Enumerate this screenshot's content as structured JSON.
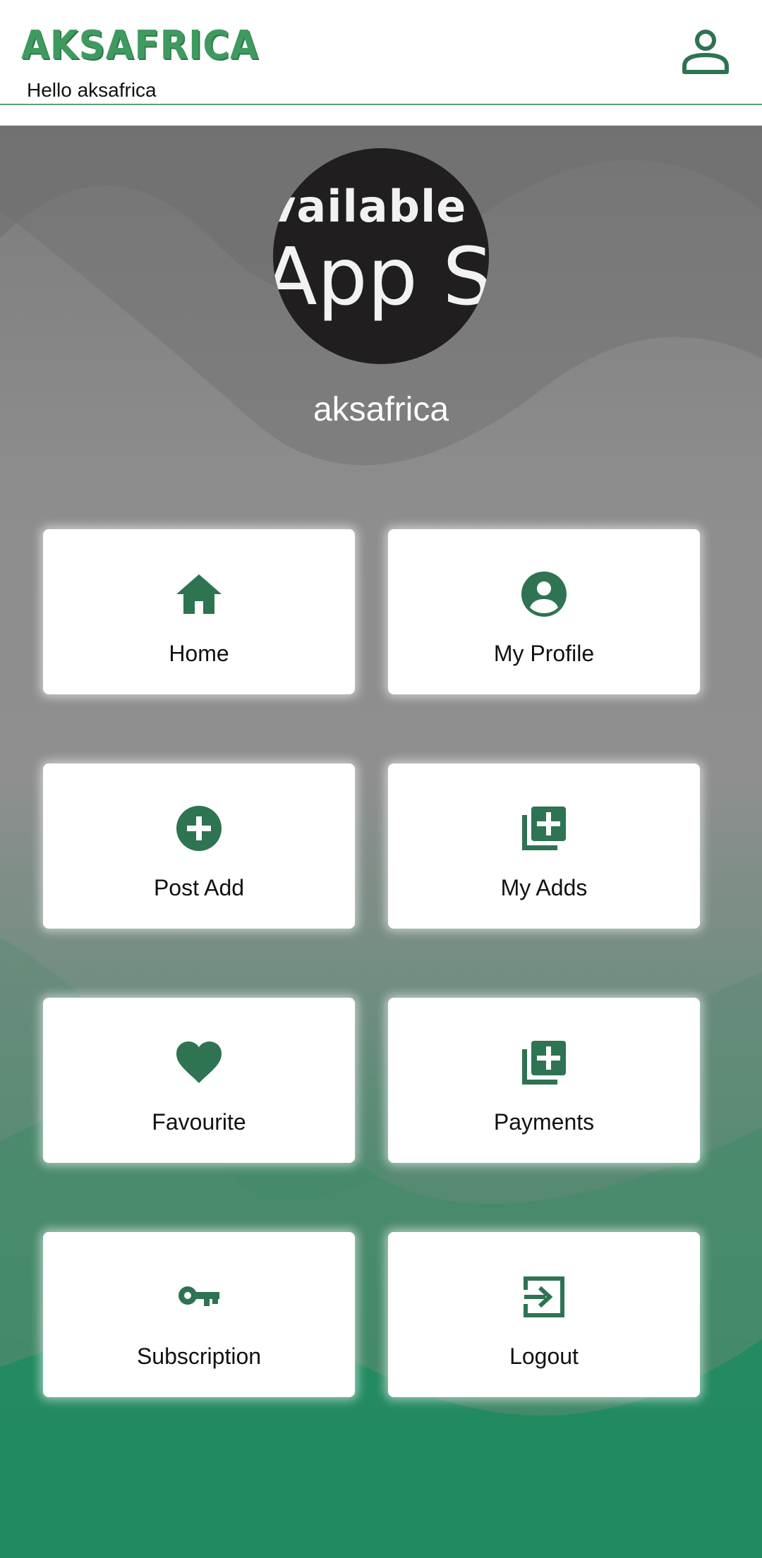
{
  "header": {
    "logo_text": "AKSAFRICA",
    "greeting": "Hello aksafrica",
    "profile_icon": "person-outline-icon"
  },
  "profile": {
    "avatar_text_line1": "vailable",
    "avatar_text_line2": "App S",
    "username": "aksafrica"
  },
  "menu": [
    {
      "label": "Home",
      "icon": "home-icon"
    },
    {
      "label": "My Profile",
      "icon": "account-circle-icon"
    },
    {
      "label": "Post Add",
      "icon": "add-circle-icon"
    },
    {
      "label": "My Adds",
      "icon": "library-add-icon"
    },
    {
      "label": "Favourite",
      "icon": "heart-icon"
    },
    {
      "label": "Payments",
      "icon": "library-add-icon"
    },
    {
      "label": "Subscription",
      "icon": "key-icon"
    },
    {
      "label": "Logout",
      "icon": "logout-icon"
    }
  ],
  "colors": {
    "accent": "#2e7352",
    "logo": "#3f9a5f",
    "header_border": "#5a9e78"
  }
}
